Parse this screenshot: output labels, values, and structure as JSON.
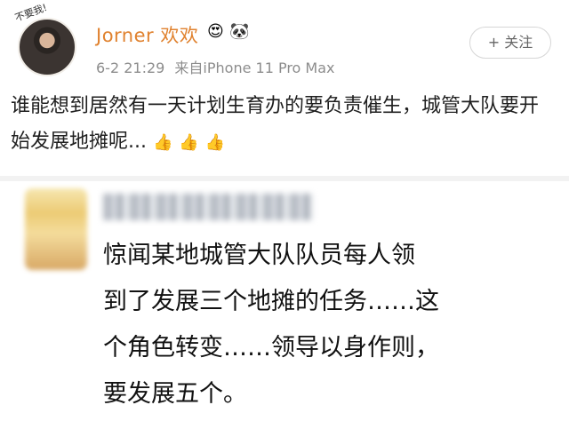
{
  "post": {
    "avatar_badge": "不要我!",
    "author_name": "Jorner 欢欢",
    "name_emojis": [
      "😍",
      "🐼"
    ],
    "timestamp": "6-2 21:29",
    "source": "来自iPhone 11 Pro Max",
    "follow_label": "+ 关注",
    "text": "谁能想到居然有一天计划生育办的要负责催生，城管大队要开始发展地摊呢...",
    "reactions": [
      "👍",
      "👍",
      "👍"
    ]
  },
  "comment": {
    "lines": [
      "惊闻某地城管大队队员每人领",
      "到了发展三个地摊的任务……这",
      "个角色转变……领导以身作则，",
      "要发展五个。"
    ]
  }
}
